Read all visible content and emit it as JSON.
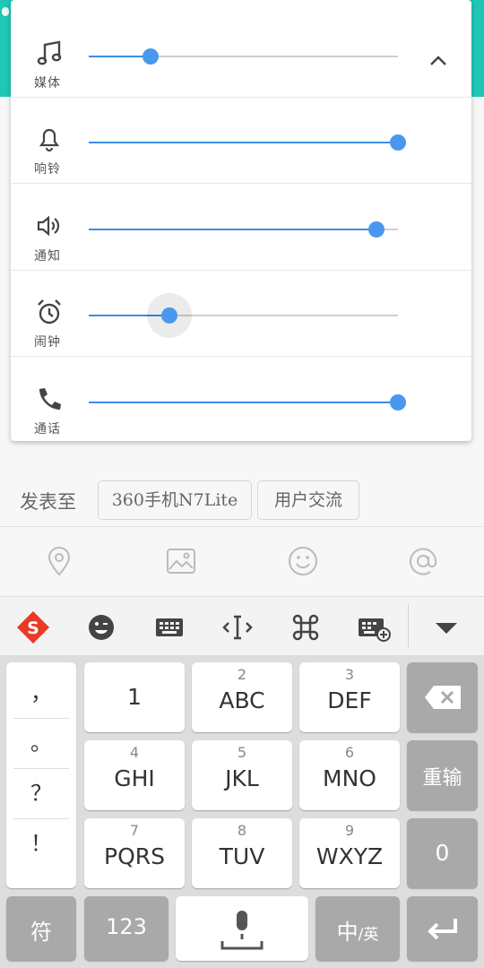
{
  "volume_panel": {
    "rows": [
      {
        "label": "媒体",
        "icon": "music-note-icon",
        "level": 0.2
      },
      {
        "label": "响铃",
        "icon": "bell-icon",
        "level": 1.0
      },
      {
        "label": "通知",
        "icon": "speaker-icon",
        "level": 0.93
      },
      {
        "label": "闹钟",
        "icon": "alarm-clock-icon",
        "level": 0.26
      },
      {
        "label": "通话",
        "icon": "phone-icon",
        "level": 1.0
      }
    ],
    "accent_color": "#3a8ee6"
  },
  "post_to": {
    "label": "发表至",
    "chips": [
      "360手机N7Lite",
      "用户交流"
    ]
  },
  "compose_tools": [
    "location-pin-icon",
    "image-icon",
    "emoji-icon",
    "at-icon"
  ],
  "keyboard_toolbar": [
    "sogou-logo-icon",
    "emoji-face-icon",
    "keyboard-icon",
    "cursor-move-icon",
    "command-icon",
    "keyboard-settings-icon",
    "collapse-keyboard-icon"
  ],
  "keyboard": {
    "punctuation": [
      "，",
      "。",
      "？",
      "！"
    ],
    "keys": [
      {
        "num": "",
        "main": "1"
      },
      {
        "num": "2",
        "main": "ABC"
      },
      {
        "num": "3",
        "main": "DEF"
      },
      {
        "num": "4",
        "main": "GHI"
      },
      {
        "num": "5",
        "main": "JKL"
      },
      {
        "num": "6",
        "main": "MNO"
      },
      {
        "num": "7",
        "main": "PQRS"
      },
      {
        "num": "8",
        "main": "TUV"
      },
      {
        "num": "9",
        "main": "WXYZ"
      }
    ],
    "retype": "重输",
    "zero": "0",
    "symbols": "符",
    "numbers": "123",
    "lang_main": "中",
    "lang_alt": "/英"
  }
}
